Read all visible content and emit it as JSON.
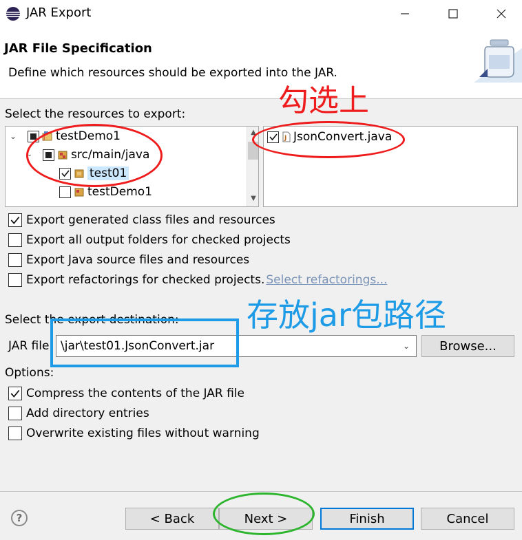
{
  "window": {
    "title": "JAR Export",
    "minimize_icon": "minimize-icon",
    "maximize_icon": "maximize-icon",
    "close_icon": "close-icon"
  },
  "header": {
    "title": "JAR File Specification",
    "description": "Define which resources should be exported into the JAR.",
    "banner_icon": "jar-icon"
  },
  "resources": {
    "label": "Select the resources to export:",
    "tree": [
      {
        "label": "testDemo1",
        "state": "partial",
        "expanded": true,
        "icon": "java-project-icon"
      },
      {
        "label": "src/main/java",
        "state": "partial",
        "expanded": true,
        "icon": "source-folder-icon"
      },
      {
        "label": "test01",
        "state": "checked",
        "selected": true,
        "icon": "package-icon"
      },
      {
        "label": "testDemo1",
        "state": "unchecked",
        "icon": "package-icon"
      }
    ],
    "files": [
      {
        "label": "JsonConvert.java",
        "state": "checked",
        "icon": "java-file-icon"
      }
    ]
  },
  "options_top": [
    {
      "text": "Export generated class files and resources",
      "checked": true,
      "mnemonic_index": 24
    },
    {
      "text": "Export all output folders for checked projects",
      "checked": false,
      "mnemonic_index": 13
    },
    {
      "text": "Export Java source files and resources",
      "checked": false,
      "mnemonic_index": 17
    },
    {
      "text": "Export refactorings for checked projects.",
      "checked": false,
      "mnemonic_index": 7
    }
  ],
  "select_refactorings_link": "Select refactorings...",
  "destination": {
    "label": "Select the export destination:",
    "jar_file_label": "JAR file:",
    "jar_file_value": "\\jar\\test01.JsonConvert.jar",
    "browse_label": "Browse..."
  },
  "options": {
    "label": "Options:",
    "items": [
      {
        "text": "Compress the contents of the JAR file",
        "checked": true
      },
      {
        "text": "Add directory entries",
        "checked": false
      },
      {
        "text": "Overwrite existing files without warning",
        "checked": false
      }
    ]
  },
  "buttons": {
    "back": "< Back",
    "next": "Next >",
    "finish": "Finish",
    "cancel": "Cancel",
    "help": "?"
  },
  "annotations": {
    "check_note": "勾选上",
    "path_note": "存放jar包路径",
    "red": "#ee1c1c",
    "blue": "#1e9be6",
    "green": "#2db52d"
  }
}
